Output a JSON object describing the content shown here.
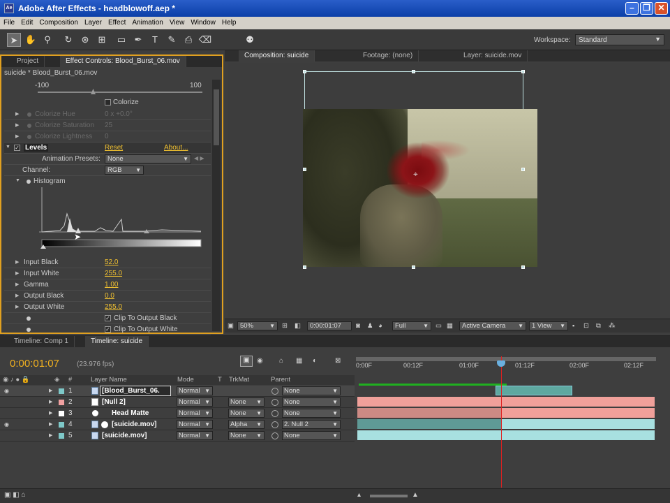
{
  "window": {
    "title": "Adobe After Effects - headblowoff.aep *",
    "app_icon": "Ae"
  },
  "menu": [
    "File",
    "Edit",
    "Composition",
    "Layer",
    "Effect",
    "Animation",
    "View",
    "Window",
    "Help"
  ],
  "toolbar": {
    "tools": [
      "selection-tool-icon",
      "hand-tool-icon",
      "zoom-tool-icon",
      "rotate-tool-icon",
      "camera-orbit-icon",
      "pan-behind-icon",
      "rectangle-mask-icon",
      "pen-tool-icon",
      "type-tool-icon",
      "brush-tool-icon",
      "clone-stamp-icon",
      "eraser-tool-icon",
      "puppet-pin-icon"
    ],
    "workspace_label": "Workspace:",
    "workspace_value": "Standard"
  },
  "effect_controls": {
    "tabs": [
      "Project",
      "Effect Controls: Blood_Burst_06.mov"
    ],
    "crumb": "suicide * Blood_Burst_06.mov",
    "slider_min": "-100",
    "slider_max": "100",
    "colorize_label": "Colorize",
    "colorize_rows": [
      {
        "label": "Colorize Hue",
        "value": "0 x +0.0°"
      },
      {
        "label": "Colorize Saturation",
        "value": "25"
      },
      {
        "label": "Colorize Lightness",
        "value": "0"
      }
    ],
    "levels": {
      "name": "Levels",
      "reset": "Reset",
      "about": "About..."
    },
    "animation_presets_label": "Animation Presets:",
    "animation_presets_value": "None",
    "channel_label": "Channel:",
    "channel_value": "RGB",
    "histogram_label": "Histogram",
    "params": [
      {
        "label": "Input Black",
        "value": "52.0"
      },
      {
        "label": "Input White",
        "value": "255.0"
      },
      {
        "label": "Gamma",
        "value": "1.00"
      },
      {
        "label": "Output Black",
        "value": "0.0"
      },
      {
        "label": "Output White",
        "value": "255.0"
      }
    ],
    "clip_black": "Clip To Output Black",
    "clip_white": "Clip To Output White"
  },
  "composition": {
    "tabs": [
      "Composition: suicide",
      "Footage: (none)",
      "Layer: suicide.mov"
    ],
    "zoom": "50%",
    "timecode": "0:00:01:07",
    "resolution": "Full",
    "camera": "Active Camera",
    "views": "1 View"
  },
  "timeline": {
    "tabs": [
      "Timeline: Comp 1",
      "Timeline: suicide"
    ],
    "timecode": "0:00:01:07",
    "fps": "(23.976 fps)",
    "columns": {
      "hash": "#",
      "layer_name": "Layer Name",
      "mode": "Mode",
      "t": "T",
      "trkmat": "TrkMat",
      "parent": "Parent"
    },
    "ruler": [
      "0:00F",
      "00:12F",
      "01:00F",
      "01:12F",
      "02:00F",
      "02:12F"
    ],
    "layers": [
      {
        "num": "1",
        "name": "[Blood_Burst_06.",
        "mode": "Normal",
        "trkmat": "",
        "parent": "None",
        "color": "#7ec8c8"
      },
      {
        "num": "2",
        "name": "[Null 2]",
        "mode": "Normal",
        "trkmat": "None",
        "parent": "None",
        "color": "#f0a0a0"
      },
      {
        "num": "3",
        "name": "Head Matte",
        "mode": "Normal",
        "trkmat": "None",
        "parent": "None",
        "color": "#ffffff"
      },
      {
        "num": "4",
        "name": "[suicide.mov]",
        "mode": "Normal",
        "trkmat": "Alpha",
        "parent": "2. Null 2",
        "color": "#7ec8c8"
      },
      {
        "num": "5",
        "name": "[suicide.mov]",
        "mode": "Normal",
        "trkmat": "None",
        "parent": "None",
        "color": "#7ec8c8"
      }
    ]
  },
  "colors": {
    "accent_timecode": "#f0b020",
    "panel_highlight": "#e0a020",
    "cti": "#e02020"
  }
}
